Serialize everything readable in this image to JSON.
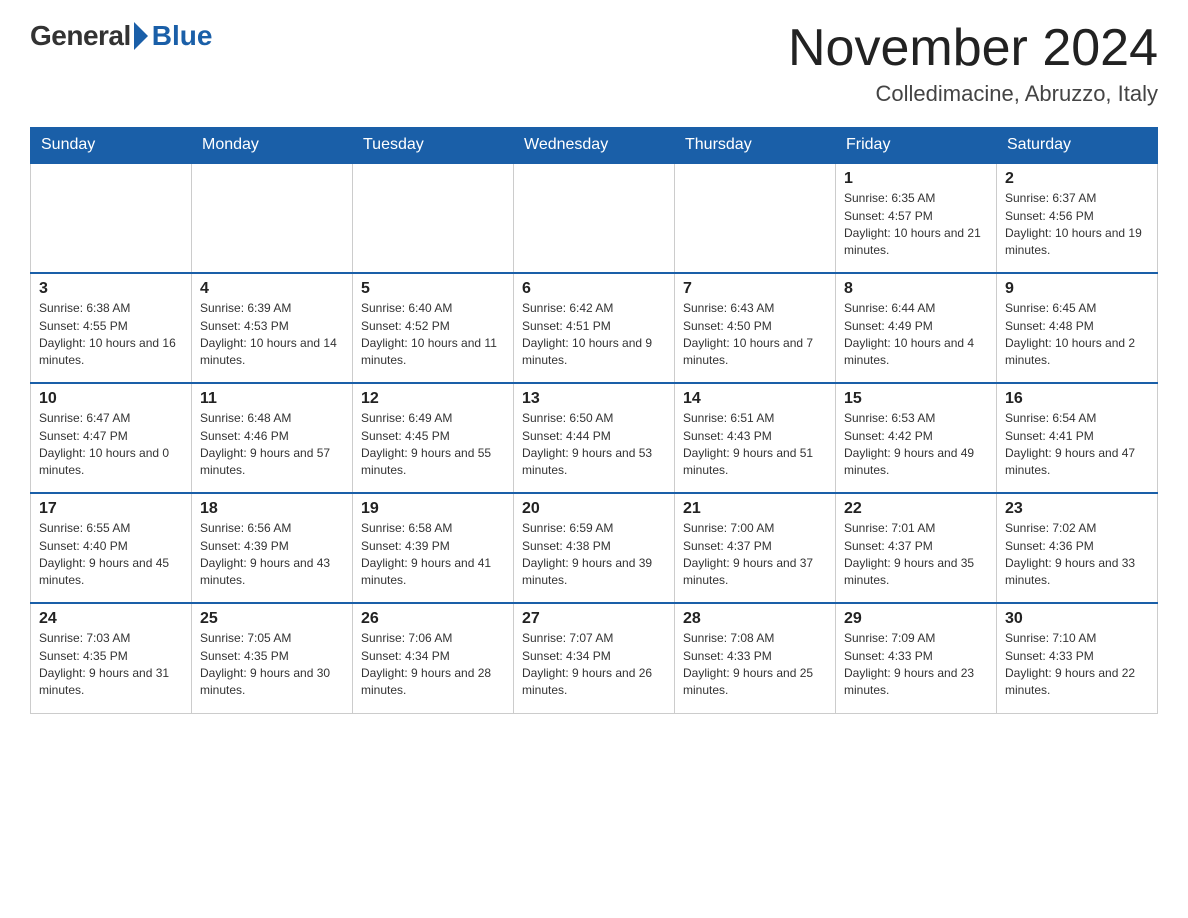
{
  "logo": {
    "general": "General",
    "blue": "Blue"
  },
  "title": {
    "month_year": "November 2024",
    "location": "Colledimacine, Abruzzo, Italy"
  },
  "weekdays": [
    "Sunday",
    "Monday",
    "Tuesday",
    "Wednesday",
    "Thursday",
    "Friday",
    "Saturday"
  ],
  "weeks": [
    [
      {
        "day": "",
        "info": ""
      },
      {
        "day": "",
        "info": ""
      },
      {
        "day": "",
        "info": ""
      },
      {
        "day": "",
        "info": ""
      },
      {
        "day": "",
        "info": ""
      },
      {
        "day": "1",
        "info": "Sunrise: 6:35 AM\nSunset: 4:57 PM\nDaylight: 10 hours and 21 minutes."
      },
      {
        "day": "2",
        "info": "Sunrise: 6:37 AM\nSunset: 4:56 PM\nDaylight: 10 hours and 19 minutes."
      }
    ],
    [
      {
        "day": "3",
        "info": "Sunrise: 6:38 AM\nSunset: 4:55 PM\nDaylight: 10 hours and 16 minutes."
      },
      {
        "day": "4",
        "info": "Sunrise: 6:39 AM\nSunset: 4:53 PM\nDaylight: 10 hours and 14 minutes."
      },
      {
        "day": "5",
        "info": "Sunrise: 6:40 AM\nSunset: 4:52 PM\nDaylight: 10 hours and 11 minutes."
      },
      {
        "day": "6",
        "info": "Sunrise: 6:42 AM\nSunset: 4:51 PM\nDaylight: 10 hours and 9 minutes."
      },
      {
        "day": "7",
        "info": "Sunrise: 6:43 AM\nSunset: 4:50 PM\nDaylight: 10 hours and 7 minutes."
      },
      {
        "day": "8",
        "info": "Sunrise: 6:44 AM\nSunset: 4:49 PM\nDaylight: 10 hours and 4 minutes."
      },
      {
        "day": "9",
        "info": "Sunrise: 6:45 AM\nSunset: 4:48 PM\nDaylight: 10 hours and 2 minutes."
      }
    ],
    [
      {
        "day": "10",
        "info": "Sunrise: 6:47 AM\nSunset: 4:47 PM\nDaylight: 10 hours and 0 minutes."
      },
      {
        "day": "11",
        "info": "Sunrise: 6:48 AM\nSunset: 4:46 PM\nDaylight: 9 hours and 57 minutes."
      },
      {
        "day": "12",
        "info": "Sunrise: 6:49 AM\nSunset: 4:45 PM\nDaylight: 9 hours and 55 minutes."
      },
      {
        "day": "13",
        "info": "Sunrise: 6:50 AM\nSunset: 4:44 PM\nDaylight: 9 hours and 53 minutes."
      },
      {
        "day": "14",
        "info": "Sunrise: 6:51 AM\nSunset: 4:43 PM\nDaylight: 9 hours and 51 minutes."
      },
      {
        "day": "15",
        "info": "Sunrise: 6:53 AM\nSunset: 4:42 PM\nDaylight: 9 hours and 49 minutes."
      },
      {
        "day": "16",
        "info": "Sunrise: 6:54 AM\nSunset: 4:41 PM\nDaylight: 9 hours and 47 minutes."
      }
    ],
    [
      {
        "day": "17",
        "info": "Sunrise: 6:55 AM\nSunset: 4:40 PM\nDaylight: 9 hours and 45 minutes."
      },
      {
        "day": "18",
        "info": "Sunrise: 6:56 AM\nSunset: 4:39 PM\nDaylight: 9 hours and 43 minutes."
      },
      {
        "day": "19",
        "info": "Sunrise: 6:58 AM\nSunset: 4:39 PM\nDaylight: 9 hours and 41 minutes."
      },
      {
        "day": "20",
        "info": "Sunrise: 6:59 AM\nSunset: 4:38 PM\nDaylight: 9 hours and 39 minutes."
      },
      {
        "day": "21",
        "info": "Sunrise: 7:00 AM\nSunset: 4:37 PM\nDaylight: 9 hours and 37 minutes."
      },
      {
        "day": "22",
        "info": "Sunrise: 7:01 AM\nSunset: 4:37 PM\nDaylight: 9 hours and 35 minutes."
      },
      {
        "day": "23",
        "info": "Sunrise: 7:02 AM\nSunset: 4:36 PM\nDaylight: 9 hours and 33 minutes."
      }
    ],
    [
      {
        "day": "24",
        "info": "Sunrise: 7:03 AM\nSunset: 4:35 PM\nDaylight: 9 hours and 31 minutes."
      },
      {
        "day": "25",
        "info": "Sunrise: 7:05 AM\nSunset: 4:35 PM\nDaylight: 9 hours and 30 minutes."
      },
      {
        "day": "26",
        "info": "Sunrise: 7:06 AM\nSunset: 4:34 PM\nDaylight: 9 hours and 28 minutes."
      },
      {
        "day": "27",
        "info": "Sunrise: 7:07 AM\nSunset: 4:34 PM\nDaylight: 9 hours and 26 minutes."
      },
      {
        "day": "28",
        "info": "Sunrise: 7:08 AM\nSunset: 4:33 PM\nDaylight: 9 hours and 25 minutes."
      },
      {
        "day": "29",
        "info": "Sunrise: 7:09 AM\nSunset: 4:33 PM\nDaylight: 9 hours and 23 minutes."
      },
      {
        "day": "30",
        "info": "Sunrise: 7:10 AM\nSunset: 4:33 PM\nDaylight: 9 hours and 22 minutes."
      }
    ]
  ]
}
